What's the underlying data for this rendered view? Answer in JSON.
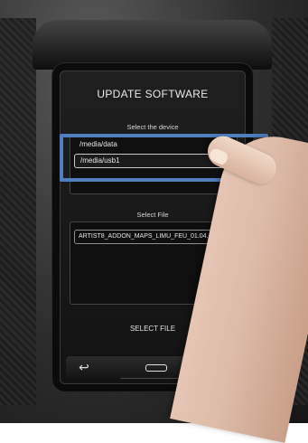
{
  "screen": {
    "title": "UPDATE SOFTWARE",
    "device_section_label": "Select the device",
    "devices": [
      "/media/data",
      "/media/usb1"
    ],
    "file_section_label": "Select File",
    "files": [
      "ARTIST8_ADDON_MAPS_LIMU_FEU_01.04..."
    ],
    "action_label": "SELECT FILE"
  },
  "nav": {
    "back_icon": "↩",
    "home_icon": "home-pill",
    "close_icon": "✕"
  },
  "colors": {
    "highlight": "#4f7fbf",
    "screen_bg": "#121212",
    "text": "#e6e6e6"
  }
}
